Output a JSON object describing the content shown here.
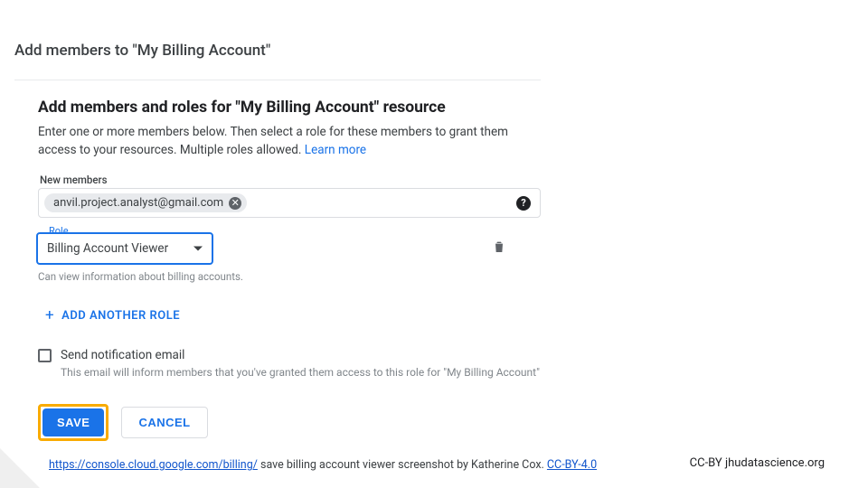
{
  "dialog": {
    "title": "Add members to \"My Billing Account\"",
    "section_title": "Add members and roles for \"My Billing Account\" resource",
    "description_a": "Enter one or more members below. Then select a role for these members to grant them access to your resources. Multiple roles allowed. ",
    "learn_more": "Learn more"
  },
  "members": {
    "label": "New members",
    "chips": [
      "anvil.project.analyst@gmail.com"
    ]
  },
  "role": {
    "label": "Role",
    "selected": "Billing Account Viewer",
    "hint": "Can view information about billing accounts."
  },
  "add_role_label": "ADD ANOTHER ROLE",
  "notify": {
    "label": "Send notification email",
    "hint": "This email will inform members that you've granted them access to this role for \"My Billing Account\""
  },
  "buttons": {
    "save": "SAVE",
    "cancel": "CANCEL"
  },
  "attribution": {
    "url_text": "https://console.cloud.google.com/billing/",
    "caption": " save  billing account viewer screenshot by Katherine Cox.  ",
    "license": "CC-BY-4.0",
    "right": "CC-BY  jhudatascience.org"
  }
}
